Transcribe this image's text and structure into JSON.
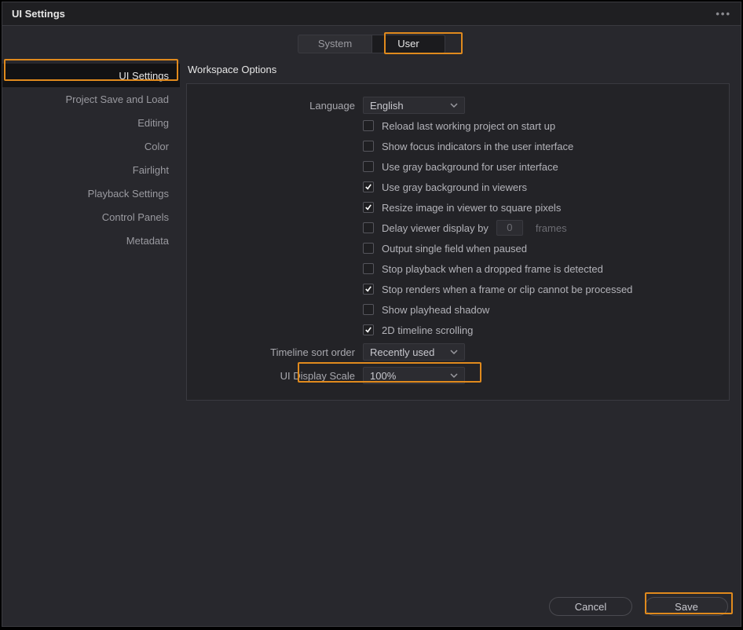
{
  "window": {
    "title": "UI Settings",
    "menu_icon": "•••"
  },
  "top_tabs": {
    "system": "System",
    "user": "User"
  },
  "sidebar": {
    "items": [
      "UI Settings",
      "Project Save and Load",
      "Editing",
      "Color",
      "Fairlight",
      "Playback Settings",
      "Control Panels",
      "Metadata"
    ],
    "active_index": 0
  },
  "section": {
    "title": "Workspace Options"
  },
  "language": {
    "label": "Language",
    "value": "English"
  },
  "checkboxes": [
    {
      "label": "Reload last working project on start up",
      "checked": false
    },
    {
      "label": "Show focus indicators in the user interface",
      "checked": false
    },
    {
      "label": "Use gray background for user interface",
      "checked": false
    },
    {
      "label": "Use gray background in viewers",
      "checked": true
    },
    {
      "label": "Resize image in viewer to square pixels",
      "checked": true
    },
    {
      "label": "Delay viewer display by",
      "checked": false,
      "trail_number": "0",
      "trail_unit": "frames"
    },
    {
      "label": "Output single field when paused",
      "checked": false
    },
    {
      "label": "Stop playback when a dropped frame is detected",
      "checked": false
    },
    {
      "label": "Stop renders when a frame or clip cannot be processed",
      "checked": true
    },
    {
      "label": "Show playhead shadow",
      "checked": false
    },
    {
      "label": "2D timeline scrolling",
      "checked": true
    }
  ],
  "sort_order": {
    "label": "Timeline sort order",
    "value": "Recently used"
  },
  "display_scale": {
    "label": "UI Display Scale",
    "value": "100%"
  },
  "footer": {
    "cancel": "Cancel",
    "save": "Save"
  }
}
